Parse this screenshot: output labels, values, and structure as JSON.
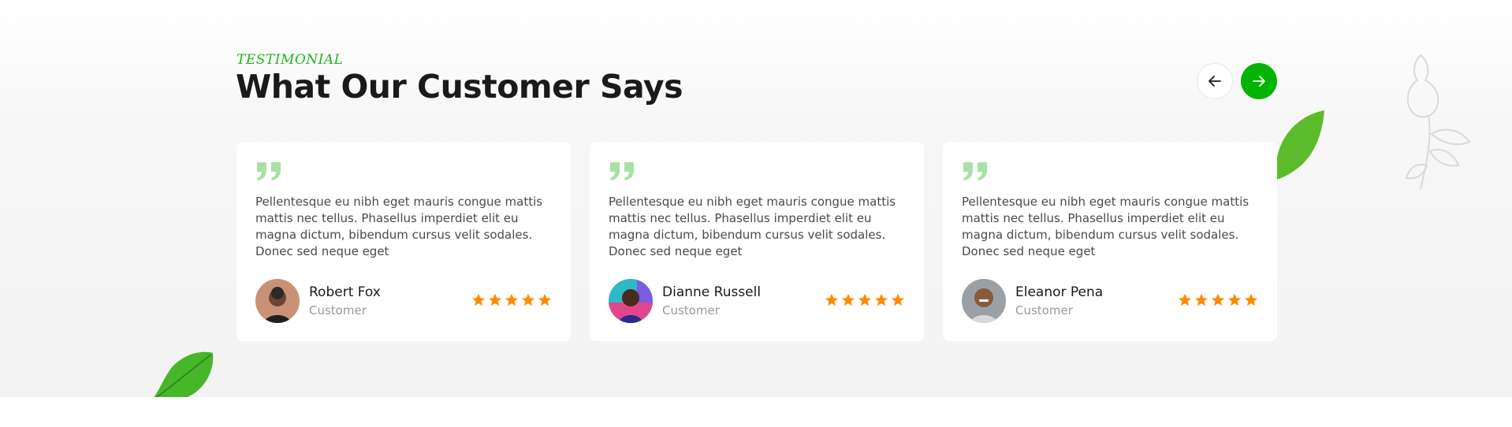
{
  "header": {
    "eyebrow": "TESTIMONIAL",
    "title": "What Our Customer Says"
  },
  "nav": {
    "prev_icon": "arrow-left-icon",
    "next_icon": "arrow-right-icon"
  },
  "colors": {
    "accent": "#04b404",
    "star": "#ff8a00",
    "quote": "#a8e0a6"
  },
  "testimonials": [
    {
      "quote": "Pellentesque eu nibh eget mauris congue mattis mattis nec tellus. Phasellus imperdiet elit eu magna dictum, bibendum cursus velit sodales. Donec sed neque eget",
      "name": "Robert Fox",
      "role": "Customer",
      "rating": 5
    },
    {
      "quote": "Pellentesque eu nibh eget mauris congue mattis mattis nec tellus. Phasellus imperdiet elit eu magna dictum, bibendum cursus velit sodales. Donec sed neque eget",
      "name": "Dianne Russell",
      "role": "Customer",
      "rating": 5
    },
    {
      "quote": "Pellentesque eu nibh eget mauris congue mattis mattis nec tellus. Phasellus imperdiet elit eu magna dictum, bibendum cursus velit sodales. Donec sed neque eget",
      "name": "Eleanor Pena",
      "role": "Customer",
      "rating": 5
    }
  ]
}
